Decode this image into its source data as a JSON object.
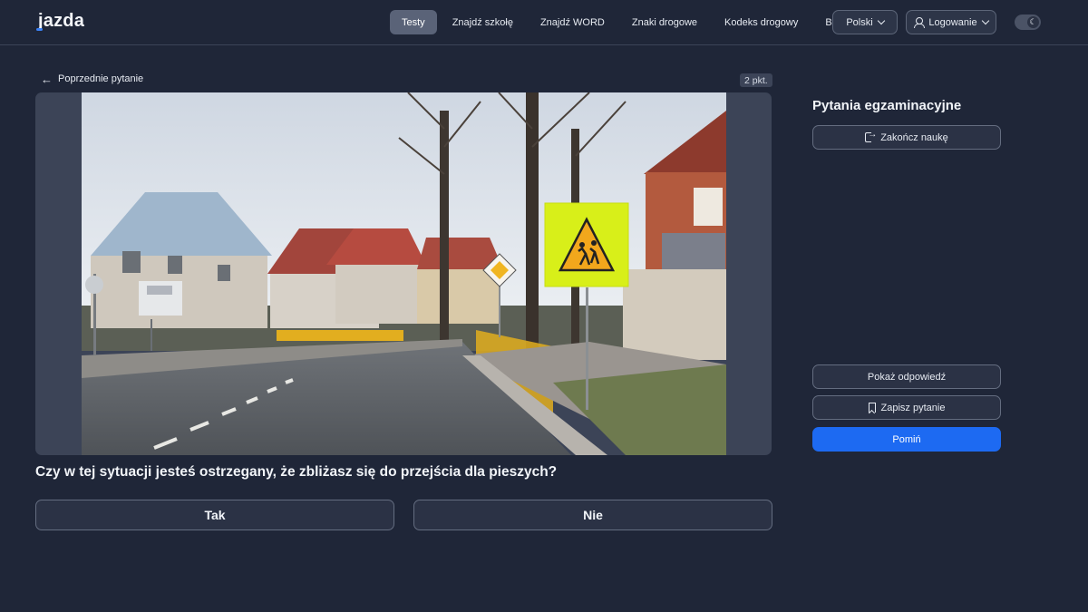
{
  "header": {
    "logo": "jazda",
    "nav": [
      "Testy",
      "Znajdź szkołę",
      "Znajdź WORD",
      "Znaki drogowe",
      "Kodeks drogowy",
      "Blog"
    ],
    "active_nav": "Testy",
    "language": "Polski",
    "login": "Logowanie",
    "theme_icon": "moon-icon"
  },
  "question": {
    "back_label": "Poprzednie pytanie",
    "points": "2 pkt.",
    "text": "Czy w tej sytuacji jesteś ostrzegany, że zbliżasz się do przejścia dla pieszych?",
    "answers": [
      "Tak",
      "Nie"
    ]
  },
  "sidebar": {
    "title": "Pytania egzaminacyjne",
    "end_label": "Zakończ naukę",
    "show_answer_label": "Pokaż odpowiedź",
    "save_label": "Zapisz pytanie",
    "skip_label": "Pomiń"
  },
  "colors": {
    "background": "#1f2638",
    "accent": "#1d6af2",
    "active_nav": "#5a6378"
  }
}
